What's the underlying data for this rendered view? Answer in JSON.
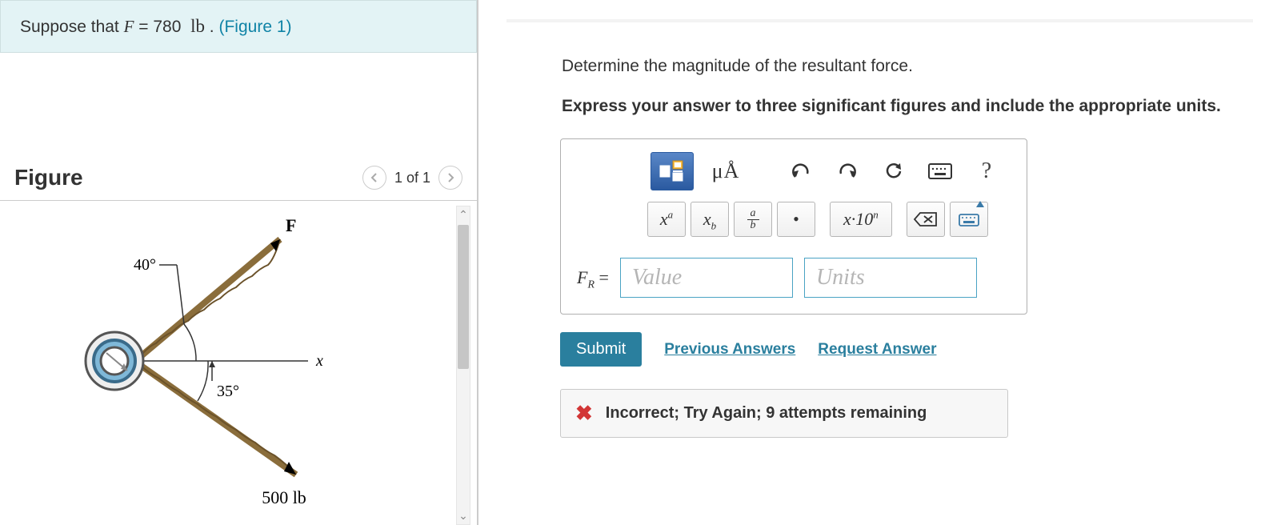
{
  "problem": {
    "prefix": "Suppose that ",
    "var": "F",
    "eq": " = 780  ",
    "unit": "lb",
    "after_unit": " . ",
    "figure_link": "(Figure 1)"
  },
  "figure": {
    "heading": "Figure",
    "pager": "1 of 1",
    "labels": {
      "force_top": "F",
      "angle_top": "40°",
      "axis": "x",
      "angle_bottom": "35°",
      "force_bottom": "500 lb"
    }
  },
  "question": {
    "prompt": "Determine the magnitude of the resultant force.",
    "instructions": "Express your answer to three significant figures and include the appropriate units."
  },
  "toolbar": {
    "mu_a": "μÅ",
    "sup": "xᵃ",
    "sub_btn": "x",
    "sub_btn_sub": "b",
    "frac_a": "a",
    "frac_b": "b",
    "dot": "•",
    "sci": "x·10",
    "sci_sup": "n",
    "help": "?"
  },
  "answer": {
    "label_var": "F",
    "label_sub": "R",
    "equals": " = ",
    "value_placeholder": "Value",
    "units_placeholder": "Units"
  },
  "actions": {
    "submit": "Submit",
    "previous": "Previous Answers",
    "request": "Request Answer"
  },
  "feedback": {
    "text": "Incorrect; Try Again; 9 attempts remaining"
  }
}
